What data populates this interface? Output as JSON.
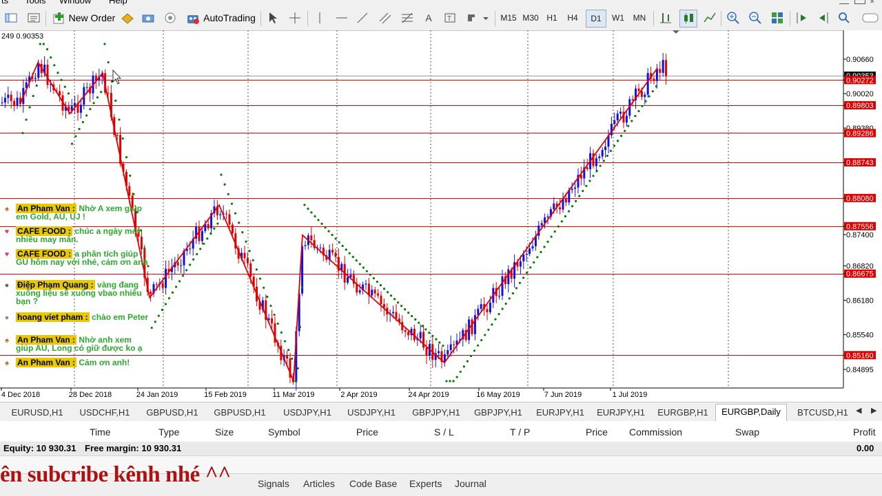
{
  "menu": [
    "ts",
    "Tools",
    "Window",
    "Help"
  ],
  "toolbar": {
    "new_order_label": "New Order",
    "autotrading_label": "AutoTrading",
    "timeframes": [
      "M15",
      "M30",
      "H1",
      "H4",
      "D1",
      "W1",
      "MN"
    ],
    "active_timeframe": "D1"
  },
  "chart": {
    "info_text": "249 0.90353",
    "price_labels": [
      "0.90660",
      "0.90353",
      "0.90272",
      "0.90020",
      "0.89803",
      "0.89380",
      "0.89286",
      "0.88743",
      "0.88080",
      "0.87556",
      "0.87400",
      "0.86820",
      "0.86675",
      "0.86180",
      "0.85540",
      "0.85160",
      "0.84895"
    ],
    "date_labels": [
      "4 Dec 2018",
      "28 Dec 2018",
      "24 Jan 2019",
      "15 Feb 2019",
      "11 Mar 2019",
      "2 Apr 2019",
      "24 Apr 2019",
      "16 May 2019",
      "7 Jun 2019",
      "1 Jul 2019"
    ]
  },
  "chart_data": {
    "type": "candlestick",
    "symbol": "EURGBP",
    "timeframe": "Daily",
    "ylim": [
      0.845,
      0.907
    ],
    "price_ticks": [
      0.9066,
      0.9002,
      0.8938,
      0.8874,
      0.881,
      0.874,
      0.8682,
      0.8618,
      0.8554,
      0.84895
    ],
    "horizontal_levels": [
      0.90353,
      0.90272,
      0.89803,
      0.89286,
      0.88743,
      0.8808,
      0.87556,
      0.86675,
      0.8516
    ],
    "current_price": 0.90353,
    "zigzag_points": [
      {
        "date": "4 Dec 2018",
        "price": 0.8985
      },
      {
        "date": "10 Dec 2018",
        "price": 0.906
      },
      {
        "date": "21 Dec 2018",
        "price": 0.8965
      },
      {
        "date": "2 Jan 2019",
        "price": 0.904
      },
      {
        "date": "21 Jan 2019",
        "price": 0.8623
      },
      {
        "date": "13 Feb 2019",
        "price": 0.8795
      },
      {
        "date": "11 Mar 2019",
        "price": 0.8468
      },
      {
        "date": "14 Mar 2019",
        "price": 0.8739
      },
      {
        "date": "29 Apr 2019",
        "price": 0.8502
      },
      {
        "date": "11 Jul 2019",
        "price": 0.905
      }
    ]
  },
  "chat": [
    {
      "user": "An Pham Van :",
      "msg": "Nhờ A xem giúp em Gold, AU, UJ !",
      "badge_color": "#b07020",
      "badge": "hat-icon"
    },
    {
      "user": "CAFE FOOD :",
      "msg": "chúc a ngày mới nhiều may mắn.",
      "badge_color": "#e0446a",
      "badge": "heart-icon"
    },
    {
      "user": "CAFE FOOD :",
      "msg": "a phân tích giúp GU hôm nay với nhé, cảm ơn anh",
      "badge_color": "#e0446a",
      "badge": "heart-icon"
    },
    {
      "user": "Điệp Phạm Quang :",
      "msg": "vàng đang xuống liệu sẽ xuống vbao nhiêu bạn ?",
      "badge_color": "#806050",
      "badge": "avatar-icon"
    },
    {
      "user": "hoang viet pham :",
      "msg": "chào em Peter",
      "badge_color": "#909090",
      "badge": "avatar-icon"
    },
    {
      "user": "An Pham Van :",
      "msg": "Nhờ anh xem giúp AU, Long có giữ được ko ạ",
      "badge_color": "#b07020",
      "badge": "hat-icon"
    },
    {
      "user": "An Pham Van :",
      "msg": "Cảm ơn anh!",
      "badge_color": "#b07020",
      "badge": "hat-icon"
    }
  ],
  "chart_tabs": [
    "EURUSD,H1",
    "USDCHF,H1",
    "GBPUSD,H1",
    "GBPUSD,H1",
    "USDJPY,H1",
    "USDJPY,H1",
    "GBPJPY,H1",
    "GBPJPY,H1",
    "EURJPY,H1",
    "EURJPY,H1",
    "EURGBP,H1",
    "EURGBP,Daily",
    "BTCUSD,H1"
  ],
  "active_chart_tab": "EURGBP,Daily",
  "terminal": {
    "columns": [
      "Time",
      "Type",
      "Size",
      "Symbol",
      "Price",
      "S / L",
      "T / P",
      "Price",
      "Commission",
      "Swap",
      "Profit"
    ],
    "equity_label": "Equity: 10 930.31",
    "free_margin_label": "Free margin: 10 930.31",
    "profit_value": "0.00",
    "bottom_tabs": [
      "Signals",
      "Articles",
      "Code Base",
      "Experts",
      "Journal"
    ]
  },
  "overlay_text": "ên subcribe kênh nhé ^^",
  "colors": {
    "bull": "#1010e0",
    "bear": "#e00000",
    "sar": "#007a00",
    "level": "#e00000",
    "zigzag": "#e00000"
  }
}
